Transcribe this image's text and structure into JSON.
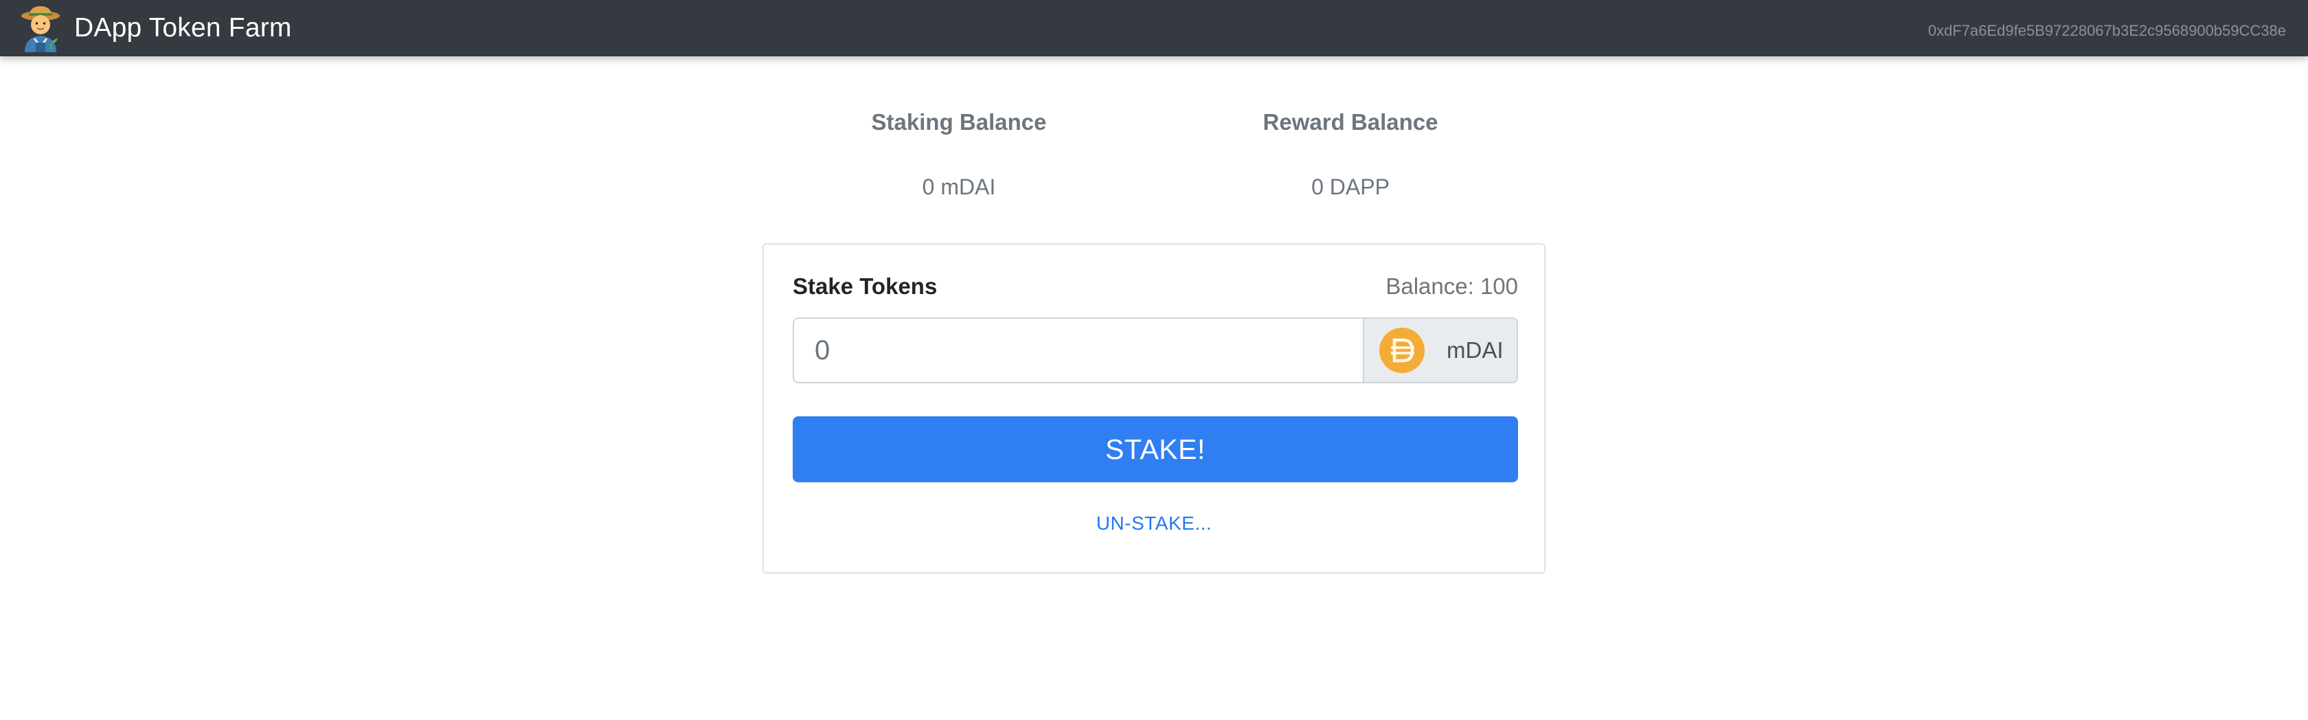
{
  "navbar": {
    "brand_text": "DApp Token Farm",
    "account": "0xdF7a6Ed9fe5B97228067b3E2c9568900b59CC38e"
  },
  "balances": {
    "staking_label": "Staking Balance",
    "staking_value": "0 mDAI",
    "reward_label": "Reward Balance",
    "reward_value": "0 DAPP"
  },
  "stake_form": {
    "title": "Stake Tokens",
    "balance_prefix": "Balance: ",
    "balance_value": "100",
    "input_placeholder": "0",
    "token_symbol": "mDAI",
    "token_icon": "dai-coin-icon",
    "stake_button_label": "STAKE!",
    "unstake_label": "UN-STAKE..."
  },
  "colors": {
    "navbar_bg": "#343a40",
    "primary_button": "#307ff2",
    "link": "#1f7bf2",
    "dai_coin": "#f5ac37"
  }
}
